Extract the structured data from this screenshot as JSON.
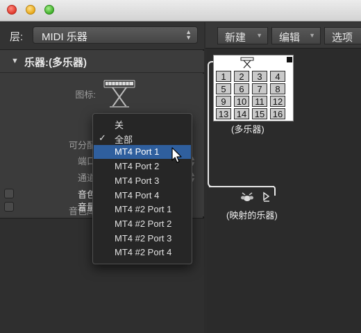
{
  "inspector": {
    "layer": {
      "label": "层:",
      "value": "MIDI 乐器"
    },
    "section_title": "乐器:(多乐器)",
    "params": {
      "icon_label": "图标:",
      "assignable_label": "可分配",
      "port_label": "端口",
      "channel_label": "通道",
      "sound_label": "音色",
      "soundbank_label": "音色库",
      "volume_label": "音量"
    }
  },
  "toolbar": {
    "new_label": "新建",
    "edit_label": "编辑",
    "options_label": "选项"
  },
  "canvas": {
    "multi_instrument_label": "(多乐器)",
    "multi_channels": [
      "1",
      "2",
      "3",
      "4",
      "5",
      "6",
      "7",
      "8",
      "9",
      "10",
      "11",
      "12",
      "13",
      "14",
      "15",
      "16"
    ],
    "mapped_label": "(映射的乐器)"
  },
  "popup": {
    "items": [
      {
        "label": "关",
        "checked": false,
        "selected": false
      },
      {
        "label": "全部",
        "checked": true,
        "selected": false
      },
      {
        "label": "MT4 Port 1",
        "checked": false,
        "selected": true
      },
      {
        "label": "MT4 Port 2",
        "checked": false,
        "selected": false
      },
      {
        "label": "MT4 Port 3",
        "checked": false,
        "selected": false
      },
      {
        "label": "MT4 Port 4",
        "checked": false,
        "selected": false
      },
      {
        "label": "MT4 #2 Port 1",
        "checked": false,
        "selected": false
      },
      {
        "label": "MT4 #2 Port 2",
        "checked": false,
        "selected": false
      },
      {
        "label": "MT4 #2 Port 3",
        "checked": false,
        "selected": false
      },
      {
        "label": "MT4 #2 Port 4",
        "checked": false,
        "selected": false
      }
    ],
    "checkmark": "✓"
  },
  "colors": {
    "menu_highlight": "#2f5f9e",
    "panel_bg": "#3a3a3a",
    "canvas_bg": "#2b2b2b"
  }
}
